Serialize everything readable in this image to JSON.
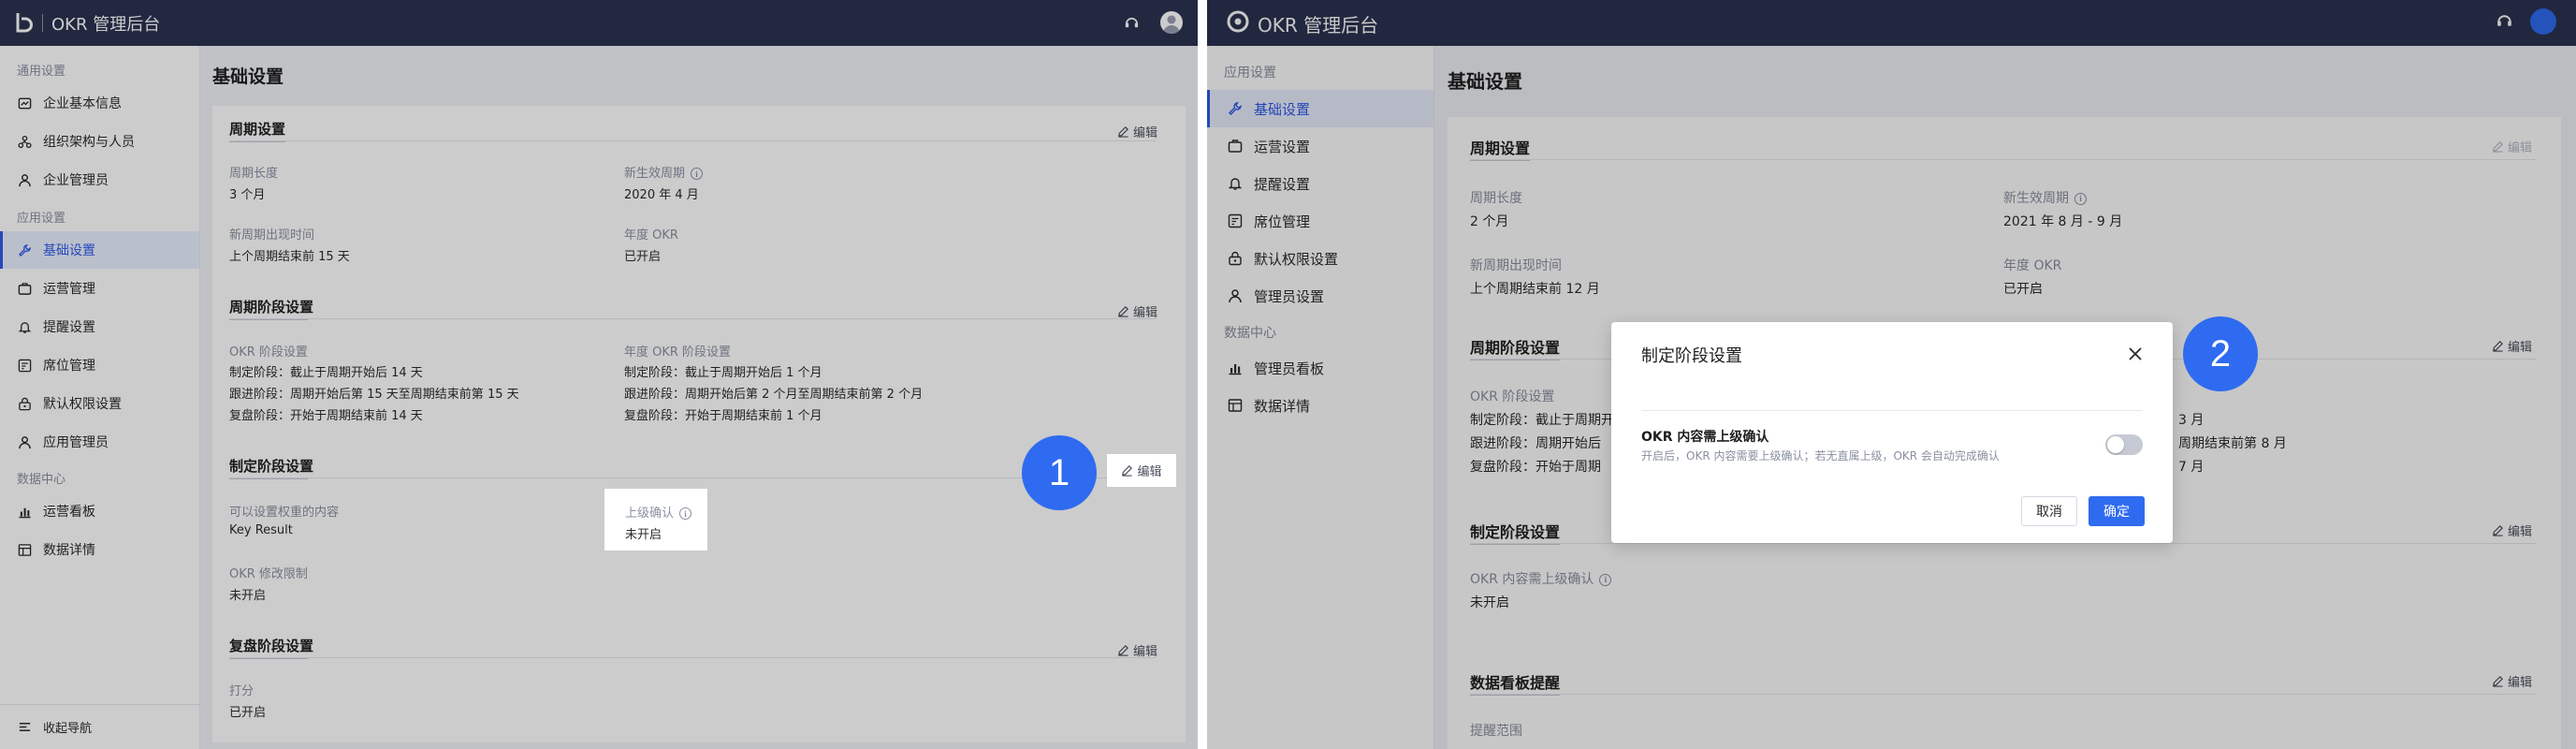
{
  "panel1": {
    "app_title": "OKR 管理后台",
    "sidebar": {
      "group1": "通用设置",
      "items1": [
        {
          "label": "企业基本信息",
          "icon": "enterprise-icon"
        },
        {
          "label": "组织架构与人员",
          "icon": "org-icon"
        },
        {
          "label": "企业管理员",
          "icon": "admin-icon"
        }
      ],
      "group2": "应用设置",
      "items2": [
        {
          "label": "基础设置",
          "icon": "wrench-icon"
        },
        {
          "label": "运营管理",
          "icon": "operations-icon"
        },
        {
          "label": "提醒设置",
          "icon": "bell-icon"
        },
        {
          "label": "席位管理",
          "icon": "seat-icon"
        },
        {
          "label": "默认权限设置",
          "icon": "lock-icon"
        },
        {
          "label": "应用管理员",
          "icon": "user-icon"
        }
      ],
      "group3": "数据中心",
      "items3": [
        {
          "label": "运营看板",
          "icon": "chart-icon"
        },
        {
          "label": "数据详情",
          "icon": "table-icon"
        }
      ],
      "collapse": "收起导航"
    },
    "page_title": "基础设置",
    "edit_label": "编辑",
    "cycle": {
      "title": "周期设置",
      "len_label": "周期长度",
      "len_value": "3 个月",
      "eff_label": "新生效周期",
      "eff_value": "2020 年 4 月",
      "new_label": "新周期出现时间",
      "new_value": "上个周期结束前 15 天",
      "year_label": "年度 OKR",
      "year_value": "已开启"
    },
    "stage": {
      "title": "周期阶段设置",
      "okr_label": "OKR 阶段设置",
      "okr_lines": [
        "制定阶段：截止于周期开始后 14 天",
        "跟进阶段：周期开始后第 15 天至周期结束前第 15 天",
        "复盘阶段：开始于周期结束前 14 天"
      ],
      "year_label": "年度 OKR 阶段设置",
      "year_lines": [
        "制定阶段：截止于周期开始后 1 个月",
        "跟进阶段：周期开始后第 2 个月至周期结束前第 2 个月",
        "复盘阶段：开始于周期结束前 1 个月"
      ]
    },
    "formulate": {
      "title": "制定阶段设置",
      "weight_label": "可以设置权重的内容",
      "weight_value": "Key Result",
      "confirm_label": "上级确认",
      "confirm_value": "未开启",
      "limit_label": "OKR 修改限制",
      "limit_value": "未开启"
    },
    "review": {
      "title": "复盘阶段设置",
      "score_label": "打分",
      "score_value": "已开启"
    },
    "badge": "1"
  },
  "panel2": {
    "app_title": "OKR 管理后台",
    "sidebar": {
      "group2": "应用设置",
      "items2": [
        {
          "label": "基础设置",
          "icon": "wrench-icon"
        },
        {
          "label": "运营设置",
          "icon": "operations-icon"
        },
        {
          "label": "提醒设置",
          "icon": "bell-icon"
        },
        {
          "label": "席位管理",
          "icon": "seat-icon"
        },
        {
          "label": "默认权限设置",
          "icon": "lock-icon"
        },
        {
          "label": "管理员设置",
          "icon": "user-icon"
        }
      ],
      "group3": "数据中心",
      "items3": [
        {
          "label": "管理员看板",
          "icon": "chart-icon"
        },
        {
          "label": "数据详情",
          "icon": "table-icon"
        }
      ]
    },
    "page_title": "基础设置",
    "edit_label": "编辑",
    "cycle": {
      "title": "周期设置",
      "len_label": "周期长度",
      "len_value": "2 个月",
      "eff_label": "新生效周期",
      "eff_value": "2021 年 8 月 - 9 月",
      "new_label": "新周期出现时间",
      "new_value": "上个周期结束前 12 月",
      "year_label": "年度 OKR",
      "year_value": "已开启"
    },
    "stage": {
      "title": "周期阶段设置",
      "okr_label": "OKR 阶段设置",
      "left_lines": [
        "制定阶段：截止于周期开",
        "跟进阶段：周期开始后",
        "复盘阶段：开始于周期"
      ],
      "right_lines": [
        "3 月",
        "周期结束前第 8 月",
        "7 月"
      ]
    },
    "formulate": {
      "title": "制定阶段设置",
      "confirm_label": "OKR 内容需上级确认",
      "confirm_value": "未开启"
    },
    "board": {
      "title": "数据看板提醒",
      "range_label": "提醒范围"
    },
    "modal": {
      "title": "制定阶段设置",
      "option_title": "OKR 内容需上级确认",
      "option_desc": "开启后，OKR 内容需要上级确认；若无直属上级，OKR 会自动完成确认",
      "toggle_on": false,
      "cancel": "取消",
      "ok": "确定"
    },
    "badge": "2"
  }
}
